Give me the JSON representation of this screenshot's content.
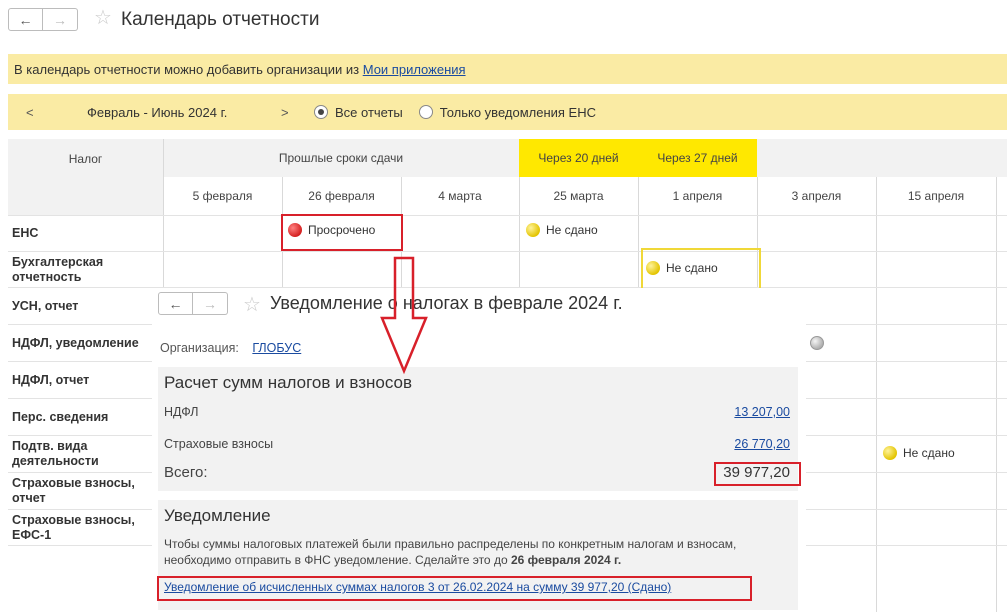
{
  "header": {
    "title": "Календарь отчетности",
    "back_icon": "←",
    "forward_icon": "→",
    "star_icon": "☆"
  },
  "banner": {
    "text": "В календарь отчетности можно добавить организации из",
    "link": "Мои приложения"
  },
  "period": {
    "prev": "<",
    "label": "Февраль - Июнь 2024 г.",
    "next": ">",
    "radio_all": "Все отчеты",
    "radio_ens": "Только уведомления ЕНС"
  },
  "grid": {
    "col_tax": "Налог",
    "col_past": "Прошлые сроки сдачи",
    "col_in20": "Через 20 дней",
    "col_in27": "Через 27 дней",
    "dates": [
      "5 февраля",
      "26 февраля",
      "4 марта",
      "25 марта",
      "1 апреля",
      "3 апреля",
      "15 апреля"
    ],
    "rows": [
      "ЕНС",
      "Бухгалтерская отчетность",
      "УСН, отчет",
      "НДФЛ, уведомление",
      "НДФЛ, отчет",
      "Перс. сведения",
      "Подтв. вида деятельности",
      "Страховые взносы, отчет",
      "Страховые взносы, ЕФС-1"
    ],
    "status_overdue": "Просрочено",
    "status_not_sent": "Не сдано"
  },
  "popup": {
    "title": "Уведомление о налогах в феврале 2024 г.",
    "org_label": "Организация:",
    "org_value": "ГЛОБУС",
    "calc": {
      "title": "Расчет сумм налогов и взносов",
      "ndfl_label": "НДФЛ",
      "ndfl_value": "13 207,00",
      "ins_label": "Страховые взносы",
      "ins_value": "26 770,20",
      "total_label": "Всего:",
      "total_value": "39 977,20"
    },
    "notice": {
      "title": "Уведомление",
      "text_main": "Чтобы суммы налоговых платежей были правильно распределены по конкретным налогам и взносам, необходимо отправить в ФНС уведомление. Сделайте это до",
      "deadline": "26 февраля 2024 г.",
      "link": "Уведомление об исчисленных суммах налогов 3 от 26.02.2024 на сумму 39 977,20 (Сдано)"
    }
  },
  "colors": {
    "banner_bg": "#faeba4",
    "highlight": "#ffe800",
    "link": "#1a4ba0",
    "annotation_red": "#d8202a"
  }
}
